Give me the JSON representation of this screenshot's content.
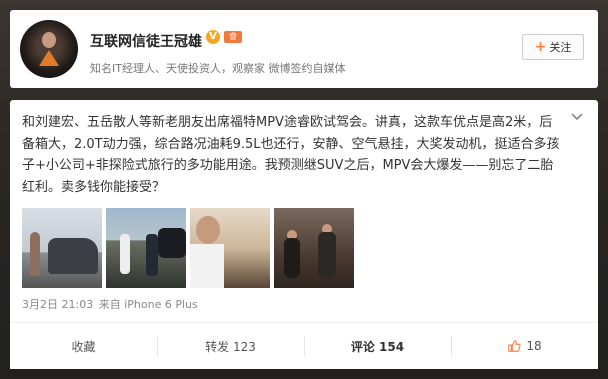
{
  "profile": {
    "username": "互联网信徒王冠雄",
    "verified_badge": "V",
    "vip_badge": "會",
    "bio": "知名IT经理人、天使投资人，观察家 微博签约自媒体",
    "follow_label": "关注",
    "follow_icon": "plus-icon",
    "accent": "#ff8140"
  },
  "post": {
    "text": "和刘建宏、五岳散人等新老朋友出席福特MPV途睿欧试驾会。讲真，这款车优点是高2米，后备箱大，2.0T动力强，综合路况油耗9.5L也还行，安静、空气悬挂，大奖发动机，挺适合多孩子+小公司+非探险式旅行的多功能用途。我预测继SUV之后，MPV会大爆发——别忘了二胎红利。卖多钱你能接受？",
    "time": "3月2日 21:03",
    "source_prefix": "来自",
    "source": "iPhone 6 Plus",
    "dropdown_icon": "chevron-down-icon"
  },
  "actions": {
    "favorite": "收藏",
    "repost": "转发 123",
    "comment": "评论 154",
    "like_count": "18",
    "like_icon": "thumbs-up-icon"
  }
}
